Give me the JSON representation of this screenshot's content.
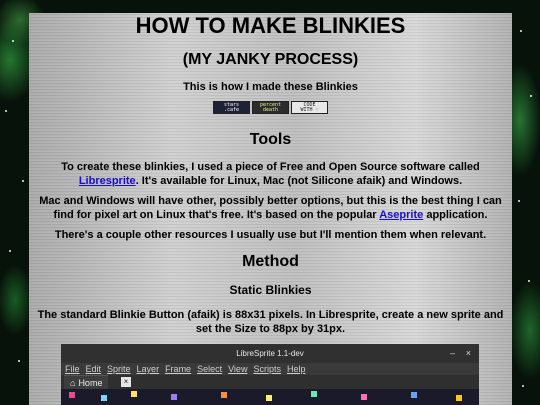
{
  "title": "HOW TO MAKE BLINKIES",
  "subtitle": "(MY JANKY PROCESS)",
  "intro": "This is how I made these Blinkies",
  "badges": [
    {
      "line1": "stars",
      "line2": ".cafe"
    },
    {
      "line1": "percent",
      "line2": "death"
    },
    {
      "line1": "CODE",
      "line2": "WITH ♡"
    }
  ],
  "tools": {
    "heading": "Tools",
    "p1_before": "To create these blinkies, I used a piece of Free and Open Source software called ",
    "p1_link": "Libresprite",
    "p1_after": ". It's available for Linux, Mac (not Silicone afaik) and Windows.",
    "p2_before": "Mac and Windows will have other, possibly better options, but this is the best thing I can find for pixel art on Linux that's free. It's based on the popular ",
    "p2_link": "Aseprite",
    "p2_after": " application.",
    "p3": "There's a couple other resources I usually use but I'll mention them when relevant."
  },
  "method": {
    "heading": "Method",
    "subheading": "Static Blinkies",
    "p1": "The standard Blinkie Button (afaik) is 88x31 pixels. In Libresprite, create a new sprite and set the Size to 88px by 31px."
  },
  "screenshot": {
    "window_title": "LibreSprite 1.1-dev",
    "menu": [
      "File",
      "Edit",
      "Sprite",
      "Layer",
      "Frame",
      "Select",
      "View",
      "Scripts",
      "Help"
    ],
    "tab_label": "Home",
    "icons": {
      "home": "home-icon",
      "close": "close-icon",
      "minimize": "minimize-icon",
      "window_close": "window-close-icon"
    }
  }
}
